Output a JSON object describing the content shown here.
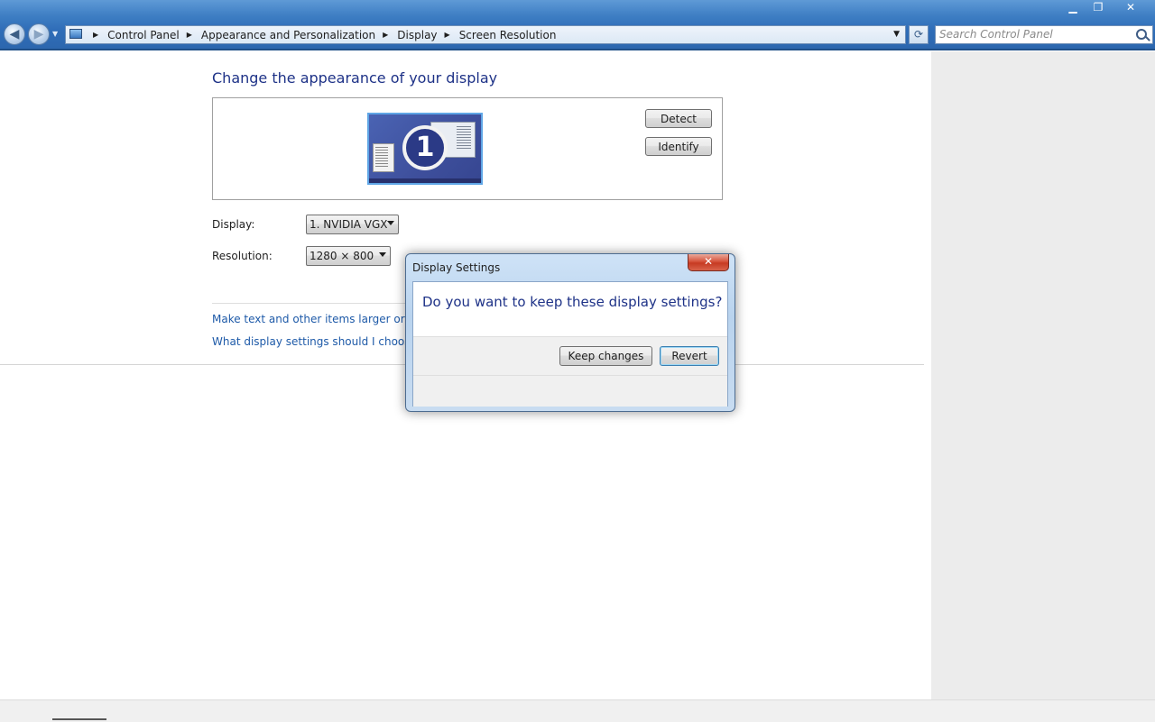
{
  "window": {
    "controls": {
      "minimize": "▁",
      "maximize": "❐",
      "close": "✕"
    }
  },
  "nav": {
    "back_icon": "◀",
    "forward_icon": "▶",
    "history_icon": "▼",
    "breadcrumbs": [
      "Control Panel",
      "Appearance and Personalization",
      "Display",
      "Screen Resolution"
    ],
    "breadcrumb_separator": "▶",
    "dropdown_icon": "▼",
    "refresh_icon": "⟳"
  },
  "search": {
    "placeholder": "Search Control Panel",
    "value": ""
  },
  "main": {
    "title": "Change the appearance of your display",
    "monitor_number": "1",
    "detect_label": "Detect",
    "identify_label": "Identify",
    "display_label": "Display:",
    "display_value": "1. NVIDIA VGX",
    "resolution_label": "Resolution:",
    "resolution_value": "1280 × 800",
    "links": [
      "Make text and other items larger or smaller",
      "What display settings should I choose?"
    ]
  },
  "dialog": {
    "title": "Display Settings",
    "close_icon": "✕",
    "question": "Do you want to keep these display settings?",
    "keep_label": "Keep changes",
    "revert_label": "Revert"
  },
  "colors": {
    "accent": "#1e3287",
    "link": "#1e5aa8",
    "titlebar": "#2f6db8",
    "close_red": "#c73a22"
  }
}
